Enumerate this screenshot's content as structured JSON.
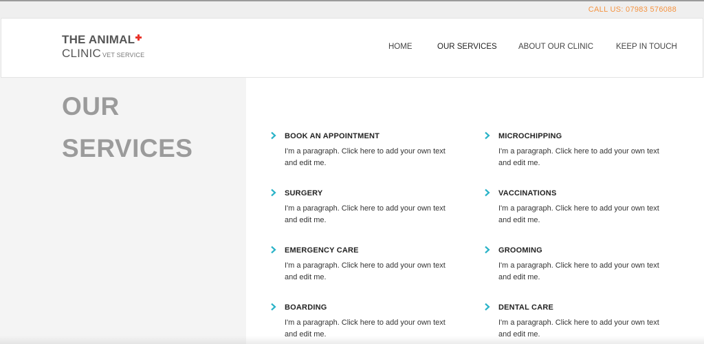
{
  "topbar": {
    "call": "CALL US: 07983 576088"
  },
  "logo": {
    "line1": "THE ANIMAL",
    "line2": "CLINIC",
    "sub": "VET SERVICE"
  },
  "nav": [
    {
      "label": "HOME"
    },
    {
      "label": "OUR SERVICES"
    },
    {
      "label": "ABOUT OUR CLINIC"
    },
    {
      "label": "KEEP IN TOUCH"
    }
  ],
  "page": {
    "title_line1": "OUR",
    "title_line2": "SERVICES"
  },
  "services": [
    {
      "title": "BOOK AN APPOINTMENT",
      "text": "I'm a paragraph. Click here to add your own text and edit me."
    },
    {
      "title": "MICROCHIPPING",
      "text": "I'm a paragraph. Click here to add your own text and edit me."
    },
    {
      "title": "SURGERY",
      "text": "I'm a paragraph. Click here to add your own text and edit me."
    },
    {
      "title": "VACCINATIONS",
      "text": "I'm a paragraph. Click here to add your own text and edit me."
    },
    {
      "title": "EMERGENCY CARE",
      "text": "I'm a paragraph. Click here to add your own text and edit me."
    },
    {
      "title": "GROOMING",
      "text": "I'm a paragraph. Click here to add your own text and edit me."
    },
    {
      "title": "BOARDING",
      "text": "I'm a paragraph. Click here to add your own text and edit me."
    },
    {
      "title": "DENTAL CARE",
      "text": "I'm a paragraph. Click here to add your own text and edit me."
    }
  ],
  "colors": {
    "accent": "#2ab3c8",
    "call": "#f5923e",
    "plus": "#e8332a",
    "title": "#9b9b9b"
  }
}
